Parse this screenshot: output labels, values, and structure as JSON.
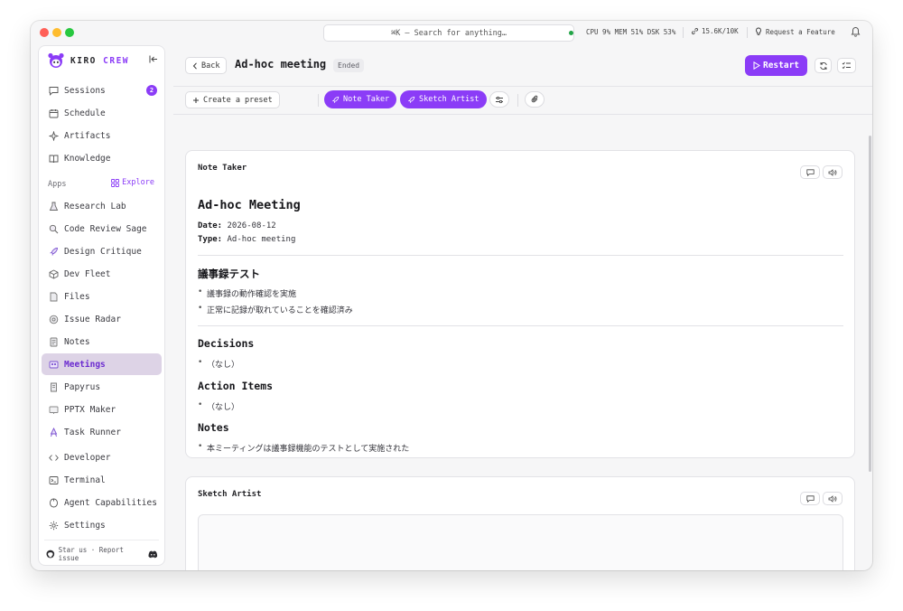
{
  "titlebar": {
    "search_text": "⌘K — Search for anything…",
    "stats": "CPU 9%  MEM 51%  DSK 53%",
    "tokens": "15.6K/10K",
    "request_feature": "Request a Feature"
  },
  "sidebar": {
    "brand_first": "KIRO",
    "brand_second": "CREW",
    "items": [
      {
        "label": "Sessions",
        "icon": "chat-icon",
        "badge": "2"
      },
      {
        "label": "Schedule",
        "icon": "calendar-icon"
      },
      {
        "label": "Artifacts",
        "icon": "sparkle-icon"
      },
      {
        "label": "Knowledge",
        "icon": "book-icon"
      }
    ],
    "apps_label": "Apps",
    "explore_label": "Explore",
    "apps": [
      {
        "label": "Research Lab",
        "icon": "flask-icon"
      },
      {
        "label": "Code Review Sage",
        "icon": "magnifier-icon"
      },
      {
        "label": "Design Critique",
        "icon": "rocket-icon"
      },
      {
        "label": "Dev Fleet",
        "icon": "cube-icon"
      },
      {
        "label": "Files",
        "icon": "file-icon"
      },
      {
        "label": "Issue Radar",
        "icon": "radar-icon"
      },
      {
        "label": "Notes",
        "icon": "note-icon"
      },
      {
        "label": "Meetings",
        "icon": "meeting-icon",
        "active": true
      },
      {
        "label": "Papyrus",
        "icon": "scroll-icon"
      },
      {
        "label": "PPTX Maker",
        "icon": "slides-icon"
      },
      {
        "label": "Task Runner",
        "icon": "runner-icon"
      }
    ],
    "bottom": [
      {
        "label": "Developer",
        "icon": "code-icon"
      },
      {
        "label": "Terminal",
        "icon": "terminal-icon"
      },
      {
        "label": "Agent Capabilities",
        "icon": "agent-icon"
      },
      {
        "label": "Settings",
        "icon": "gear-icon"
      }
    ],
    "footer": "Star us · Report issue"
  },
  "header": {
    "back_label": "Back",
    "title": "Ad-hoc meeting",
    "status": "Ended",
    "restart_label": "Restart"
  },
  "toolbar": {
    "preset_label": "Create a preset",
    "agents": [
      "Note Taker",
      "Sketch Artist"
    ]
  },
  "note_card": {
    "title": "Note Taker",
    "doc_title": "Ad-hoc Meeting",
    "date_label": "Date:",
    "date_value": "2026-08-12",
    "type_label": "Type:",
    "type_value": "Ad-hoc meeting",
    "section1": "議事録テスト",
    "section1_items": [
      "議事録の動作確認を実施",
      "正常に記録が取れていることを確認済み"
    ],
    "decisions_heading": "Decisions",
    "decisions_items": [
      "（なし）"
    ],
    "action_heading": "Action Items",
    "action_items": [
      "（なし）"
    ],
    "notes_heading": "Notes",
    "notes_items": [
      "本ミーティングは議事録機能のテストとして実施された"
    ]
  },
  "sketch_card": {
    "title": "Sketch Artist"
  },
  "colors": {
    "accent": "#8b3cf7",
    "active_bg": "#ddd3e6"
  }
}
